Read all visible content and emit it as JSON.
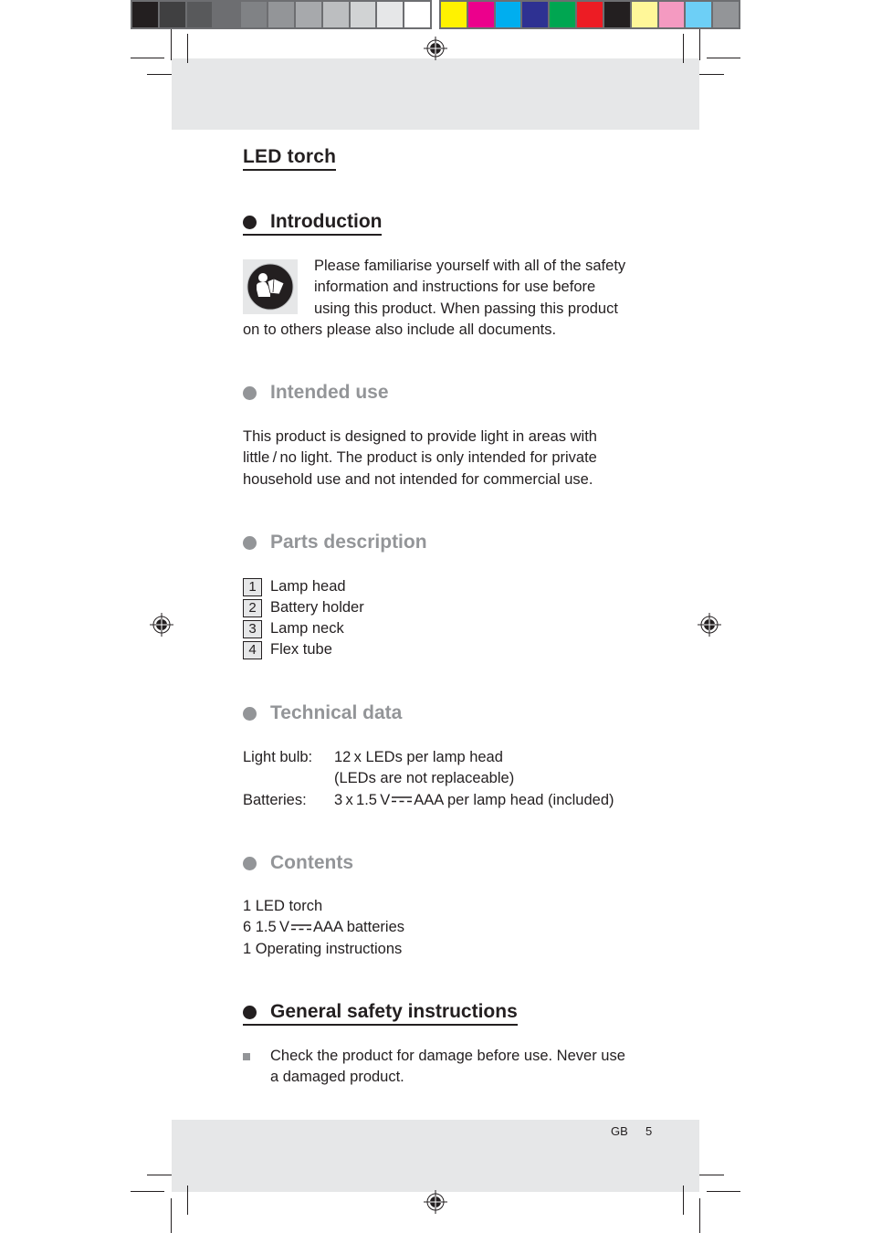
{
  "print_marks": {
    "gray_swatches": [
      "#231f20",
      "#404041",
      "#58595b",
      "#6d6e71",
      "#808285",
      "#939598",
      "#a7a9ac",
      "#bcbec0",
      "#d1d3d4",
      "#e6e7e8",
      "#ffffff"
    ],
    "color_swatches": [
      "#fff200",
      "#ec008c",
      "#00aeef",
      "#2e3192",
      "#00a651",
      "#ed1c24",
      "#231f20",
      "#fff799",
      "#f49ac1",
      "#6dcff6",
      "#939598"
    ]
  },
  "document": {
    "title": "LED torch",
    "sections": {
      "introduction": {
        "heading": "Introduction",
        "icon": "read-manual-icon",
        "text_lines": [
          "Please familiarise yourself with all of the safety",
          "information and instructions for use before",
          "using this product. When passing this product",
          "on to others please also include all documents."
        ]
      },
      "intended_use": {
        "heading": "Intended use",
        "text_lines": [
          "This product is designed to provide light in areas with",
          "little / no light. The product is only intended for private",
          "household use and not intended for commercial use."
        ]
      },
      "parts_description": {
        "heading": "Parts description",
        "items": [
          {
            "number": "1",
            "label": "Lamp head"
          },
          {
            "number": "2",
            "label": "Battery holder"
          },
          {
            "number": "3",
            "label": "Lamp neck"
          },
          {
            "number": "4",
            "label": "Flex tube"
          }
        ]
      },
      "technical_data": {
        "heading": "Technical data",
        "light_bulb_label": "Light bulb:",
        "light_bulb_value_1": "12 x LEDs per lamp head",
        "light_bulb_value_2": "(LEDs are not replaceable)",
        "batteries_label": "Batteries:",
        "batteries_value_pre": "3 x 1.5 V",
        "batteries_value_post": "AAA per lamp head (included)",
        "dc_symbol": "direct-current-icon"
      },
      "contents": {
        "heading": "Contents",
        "line_1": "1 LED torch",
        "line_2_pre": "6 1.5 V",
        "line_2_post": "AAA batteries",
        "line_3": "1 Operating instructions"
      },
      "general_safety": {
        "heading": "General safety instructions",
        "bullets": [
          {
            "line_1": "Check the product for damage before use. Never use",
            "line_2": "a damaged product."
          }
        ]
      }
    },
    "footer": {
      "language": "GB",
      "page_number": "5"
    }
  }
}
